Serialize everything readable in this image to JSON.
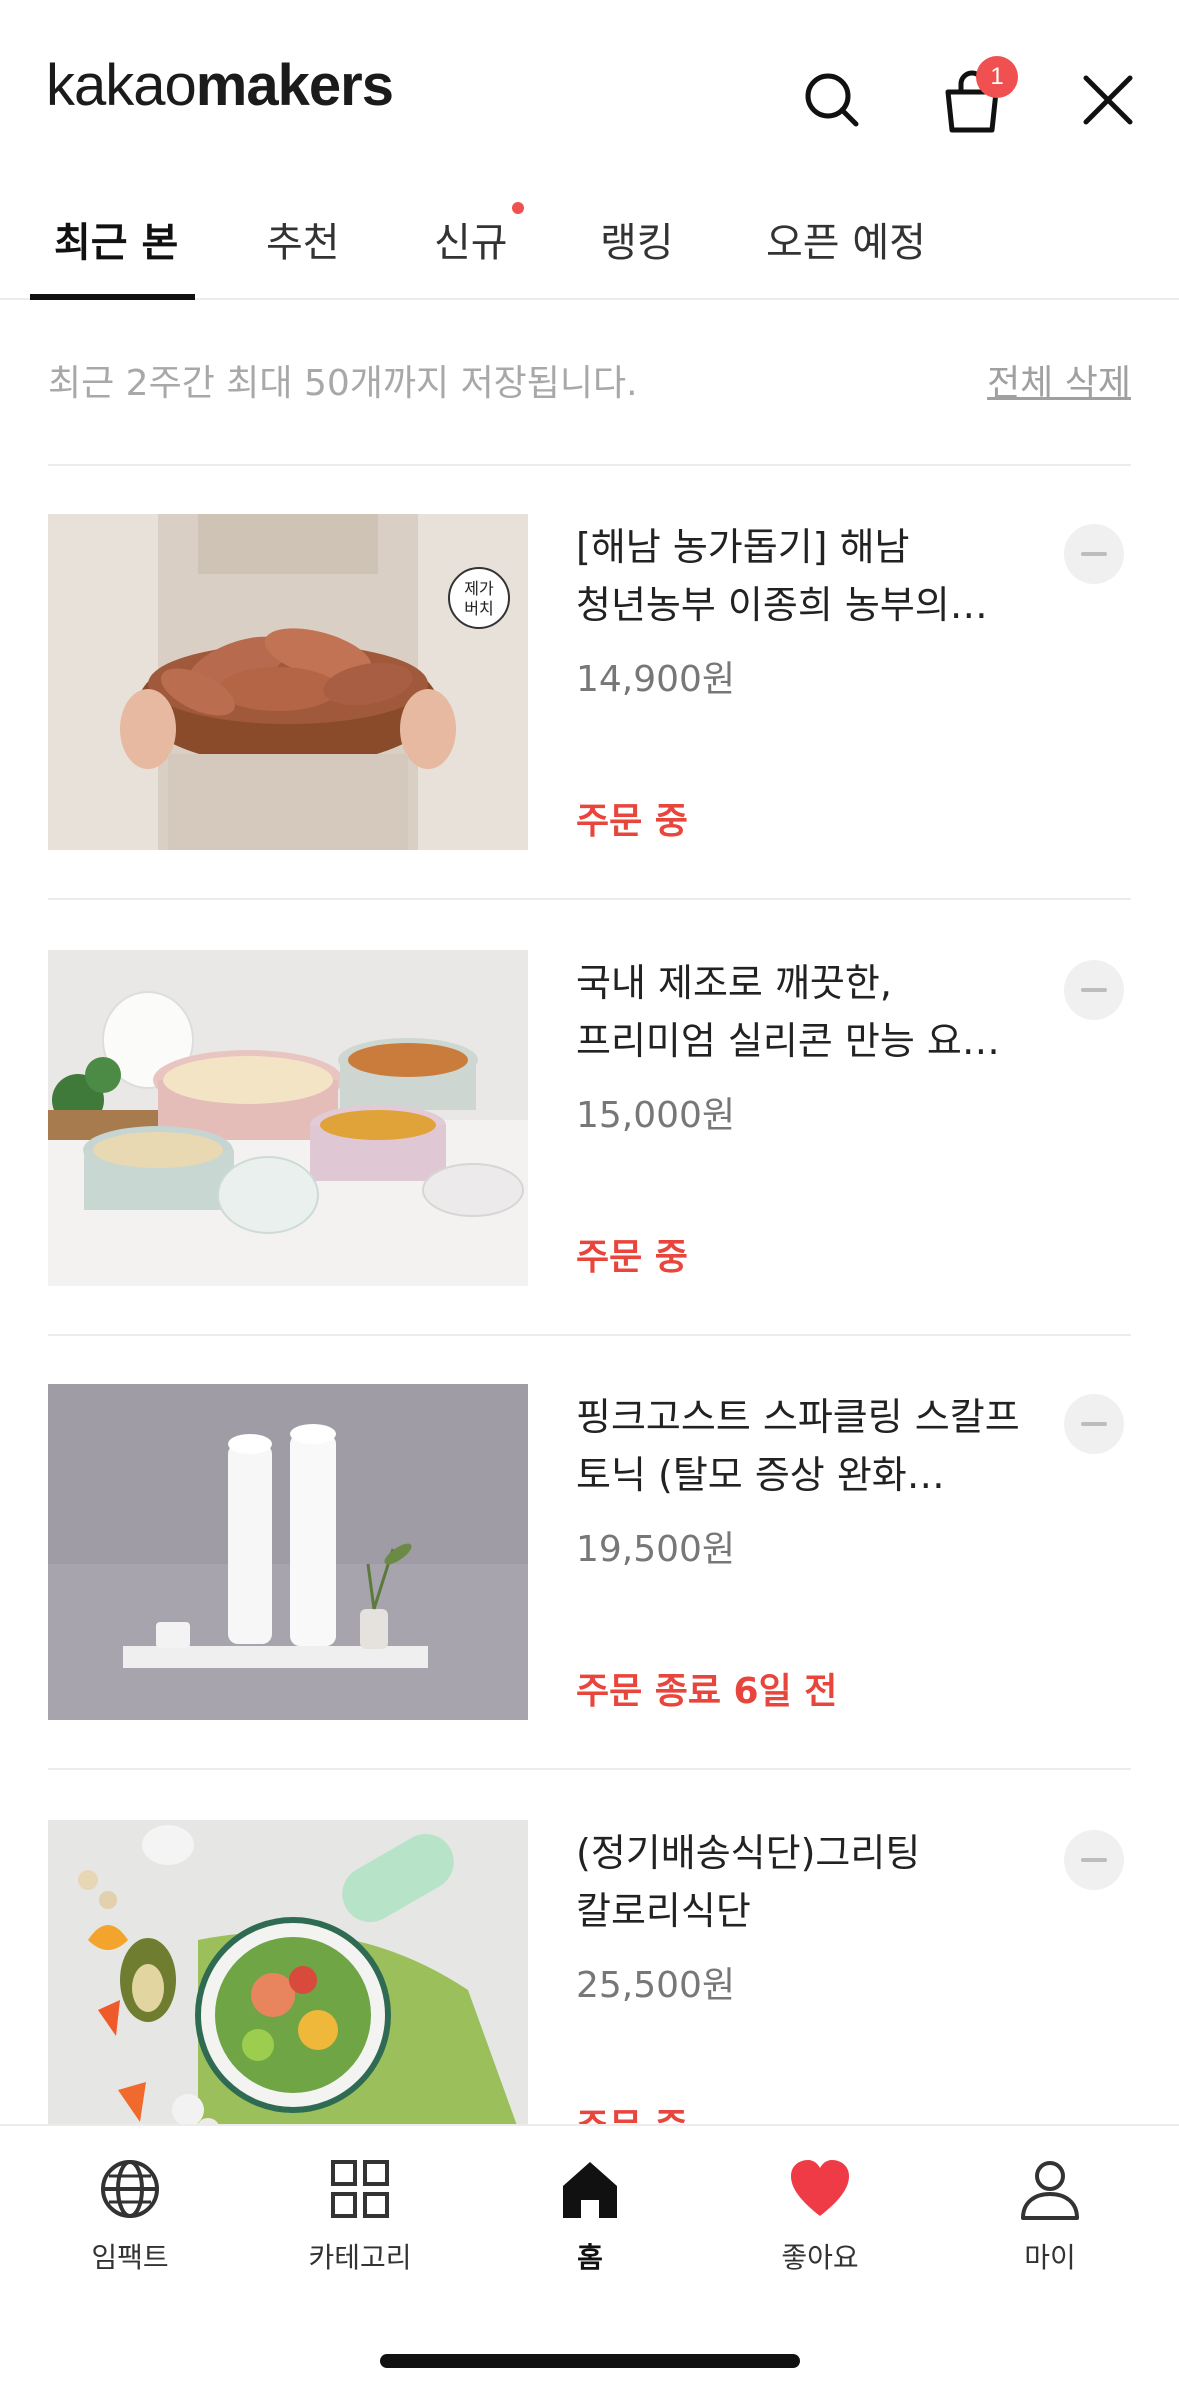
{
  "header": {
    "logo_light": "kakao",
    "logo_bold": "makers",
    "cart_count": "1",
    "icons": {
      "search": "search-icon",
      "cart": "shopping-bag-icon",
      "close": "close-icon"
    }
  },
  "tabs": [
    {
      "label": "최근 본",
      "active": true
    },
    {
      "label": "추천",
      "active": false
    },
    {
      "label": "신규",
      "active": false,
      "new_dot": true
    },
    {
      "label": "랭킹",
      "active": false
    },
    {
      "label": "오픈 예정",
      "active": false
    }
  ],
  "notice": {
    "text": "최근 2주간 최대 50개까지 저장됩니다.",
    "delete_all": "전체 삭제"
  },
  "items": [
    {
      "title_line1": "[해남 농가돕기] 해남",
      "title_line2": "청년농부 이종희 농부의…",
      "price": "14,900원",
      "status": "주문 중"
    },
    {
      "title_line1": "국내 제조로 깨끗한,",
      "title_line2": "프리미엄 실리콘 만능 요…",
      "price": "15,000원",
      "status": "주문 중"
    },
    {
      "title_line1": "핑크고스트 스파클링 스칼프",
      "title_line2": "토닉 (탈모 증상 완화…",
      "price": "19,500원",
      "status": "주문 종료 6일 전"
    },
    {
      "title_line1": "(정기배송식단)그리팅",
      "title_line2": "칼로리식단",
      "price": "25,500원",
      "status": "주문 중"
    }
  ],
  "thumb_badge": [
    "제가",
    "버치"
  ],
  "bottom_nav": [
    {
      "label": "임팩트",
      "icon": "globe-icon"
    },
    {
      "label": "카테고리",
      "icon": "grid-icon"
    },
    {
      "label": "홈",
      "icon": "home-icon",
      "active": true
    },
    {
      "label": "좋아요",
      "icon": "heart-icon"
    },
    {
      "label": "마이",
      "icon": "person-icon"
    }
  ],
  "colors": {
    "accent": "#e8453c",
    "badge": "#f05050",
    "heart": "#ee3b45"
  }
}
